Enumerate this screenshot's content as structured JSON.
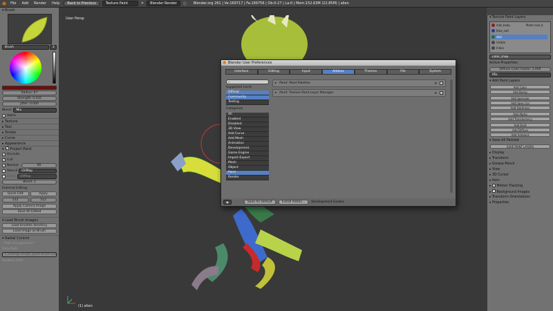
{
  "topbar": {
    "menus": [
      "File",
      "Add",
      "Render",
      "Help"
    ],
    "back_button": "Back to Previous",
    "screen_layout": "Texture Paint",
    "render_engine": "Blender Render",
    "stats": "Blender.org 261 | Ve:169717 | Fa:169756 | Ob:0-27 | La:0 | Mem:152.63M (22.85M) | alien"
  },
  "left_panel": {
    "brush_header": "Brush",
    "brush_name": "Brush",
    "brush_users": "2",
    "fields": {
      "radius": "Radius: 67",
      "strength": "Strength: 0.435",
      "jitter": "Jitter: 0.000"
    },
    "blend_label": "Blend:",
    "blend_value": "Mix",
    "alpha_label": "Alpha",
    "sections_closed": [
      "Texture",
      "Tool",
      "Stroke",
      "Curve",
      "Appearance"
    ],
    "project_paint_header": "Project Paint",
    "occlude_label": "Occlude",
    "cull_label": "Cull",
    "normal_label": "Normal",
    "normal_value": "80",
    "stencil_label": "Stencil",
    "stencil_value": "UVMap",
    "clone_label": "Clone",
    "clone_value": "UVMap",
    "bleed_value": "Bleed: 2",
    "external_editing": "External Editing:",
    "quick_edit": "Quick Edit",
    "apply": "Apply",
    "size_x": "512",
    "size_y": "512",
    "apply_camera_image": "Apply Camera Image",
    "save_all_edited": "Save All Edited",
    "load_brush_images_header": "Load Brush Images",
    "load_brushes_directory": "Load brushes directory",
    "load_image_as_brush": "Load image as Brush",
    "radial_control_header": "Radial Control",
    "path_unsupported": "* Path Unsupported *",
    "data_path": "Data Path:",
    "path_value": "t_settings.image_paint.brush.size",
    "rotation_path": "Rotation Path:"
  },
  "viewport": {
    "label": "User Persp",
    "object_label": "(1) alien"
  },
  "dialog": {
    "title": "Blender User Preferences",
    "tabs": [
      "Interface",
      "Editing",
      "Input",
      "Addons",
      "Themes",
      "File",
      "System"
    ],
    "active_tab": "Addons",
    "support_level_header": "Supported Level",
    "support_levels": [
      "Official",
      "Community",
      "Testing"
    ],
    "categories_header": "Categories",
    "categories": [
      "All",
      "Enabled",
      "Disabled",
      "3D View",
      "Add Curve",
      "Add Mesh",
      "Animation",
      "Development",
      "Game Engine",
      "Import-Export",
      "Mesh",
      "Object",
      "Paint",
      "Render"
    ],
    "selected_category": "Paint",
    "addons": [
      {
        "name": "Paint: Paint Palettes"
      },
      {
        "name": "Paint: Texture Paint Layer Manager"
      }
    ],
    "save_as_default": "Save As Default",
    "install_addon": "Install Addon...",
    "development_guides": "Development Guides"
  },
  "right_panel": {
    "layers_header": "Texture Paint Layers",
    "layers": [
      {
        "name": "mat_body",
        "color": "#8a1f1f"
      },
      {
        "name": "blue_suit",
        "color": "#2a3a8a"
      },
      {
        "name": "skin",
        "color": "#2f6a2f"
      },
      {
        "name": "Visible",
        "color": "#444444"
      },
      {
        "name": "Index",
        "color": "#444444"
      }
    ],
    "second_layer_label": "Mode mat_b",
    "color_map": "color_map",
    "active_properties": "Active Properties:",
    "diffuse_color_factor": "Diffuse Color Factor: 1.000",
    "blend_mode": "Mix",
    "add_paint_layers_header": "Add Paint Layers",
    "add_buttons": [
      "Add Color",
      "Add Bump",
      "Add Specular",
      "Add Spec Col",
      "Add Hardness",
      "Add Alpha",
      "Add Translucency",
      "Add Emit",
      "Add Diffuse",
      "Add Ambient"
    ],
    "save_all_painted_header": "Save All Painted",
    "save_paint_layers": "SAVE PAINT LAYERS",
    "sections": [
      "Display",
      "Transform",
      "Grease Pencil",
      "View",
      "3D Cursor",
      "Item",
      "Motion Tracking",
      "Background Images",
      "Transform Orientations",
      "Properties"
    ],
    "motion_tracking_checked": true,
    "background_images_checked": false
  }
}
